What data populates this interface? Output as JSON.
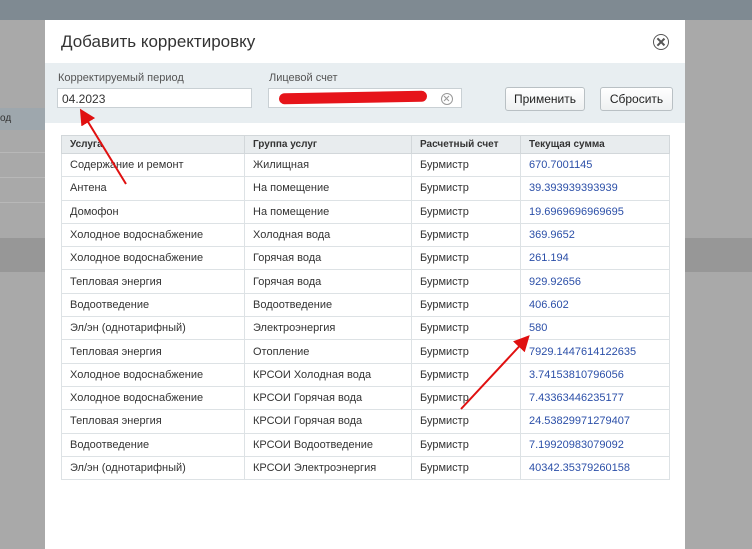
{
  "background": {
    "column_header_fragment": "од"
  },
  "modal": {
    "title": "Добавить корректировку",
    "close_icon": "close-circle-icon"
  },
  "filters": {
    "period_label": "Корректируемый период",
    "period_value": "04.2023",
    "account_label": "Лицевой счет",
    "apply_label": "Применить",
    "reset_label": "Сбросить"
  },
  "table": {
    "headers": [
      "Услуга",
      "Группа услуг",
      "Расчетный счет",
      "Текущая сумма"
    ],
    "rows": [
      [
        "Содержание и ремонт",
        "Жилищная",
        "Бурмистр",
        "670.7001145"
      ],
      [
        "Антена",
        "На помещение",
        "Бурмистр",
        "39.393939393939"
      ],
      [
        "Домофон",
        "На помещение",
        "Бурмистр",
        "19.6969696969695"
      ],
      [
        "Холодное водоснабжение",
        "Холодная вода",
        "Бурмистр",
        "369.9652"
      ],
      [
        "Холодное водоснабжение",
        "Горячая вода",
        "Бурмистр",
        "261.194"
      ],
      [
        "Тепловая энергия",
        "Горячая вода",
        "Бурмистр",
        "929.92656"
      ],
      [
        "Водоотведение",
        "Водоотведение",
        "Бурмистр",
        "406.602"
      ],
      [
        "Эл/эн (однотарифный)",
        "Электроэнергия",
        "Бурмистр",
        "580"
      ],
      [
        "Тепловая энергия",
        "Отопление",
        "Бурмистр",
        "7929.1447614122635"
      ],
      [
        "Холодное водоснабжение",
        "КРСОИ Холодная вода",
        "Бурмистр",
        "3.74153810796056"
      ],
      [
        "Холодное водоснабжение",
        "КРСОИ Горячая вода",
        "Бурмистр",
        "7.43363446235177"
      ],
      [
        "Тепловая энергия",
        "КРСОИ Горячая вода",
        "Бурмистр",
        "24.53829971279407"
      ],
      [
        "Водоотведение",
        "КРСОИ Водоотведение",
        "Бурмистр",
        "7.19920983079092"
      ],
      [
        "Эл/эн (однотарифный)",
        "КРСОИ Электроэнергия",
        "Бурмистр",
        "40342.35379260158"
      ]
    ]
  },
  "annotations": {
    "arrow_color": "#e01010",
    "redaction_color": "#e6141a"
  }
}
